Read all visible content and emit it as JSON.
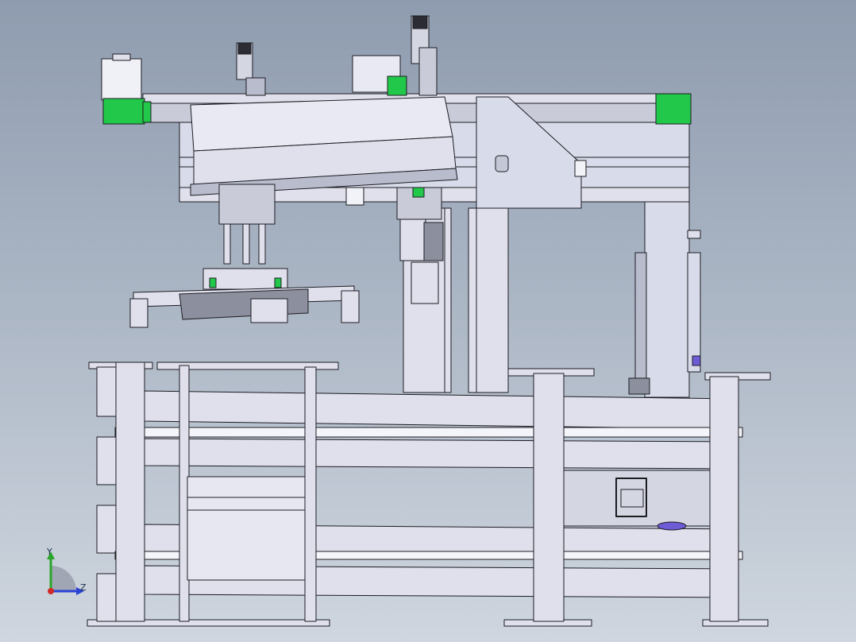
{
  "viewport": {
    "background_top": "#8f9caf",
    "background_bottom": "#cfd6df"
  },
  "model": {
    "part_fill": "#dfe0ec",
    "part_shade": "#b9bccc",
    "part_dark": "#8c8f9d",
    "edge_color": "#1c1c22",
    "accent_green": "#22c84a",
    "accent_purple": "#6e5bd6"
  },
  "triad": {
    "y_label": "Y",
    "z_label": "Z",
    "y_color": "#2aa52a",
    "z_color": "#2a43d6",
    "x_color": "#d22a2a"
  }
}
